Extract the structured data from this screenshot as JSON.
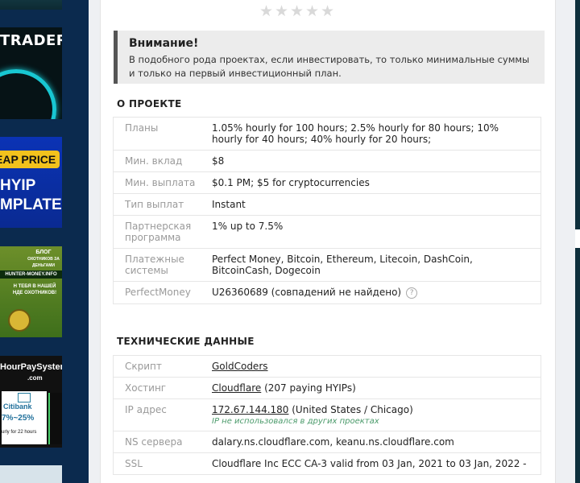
{
  "left_banners": {
    "trader": {
      "title": "TRADER"
    },
    "hyip": {
      "price_tag": "EAP PRICE",
      "line1": "HYIP",
      "line2": "MPLATE"
    },
    "hunter": {
      "blog": "БЛОГ",
      "blog_sub": "ОХОТНИКОВ ЗА ДЕНЬГАМИ",
      "url": "HUNTER-MONEY.INFO",
      "mid": "Н ТЕБЯ В НАШЕЙ НДЕ ОХОТНИКОВ!"
    },
    "hourpay": {
      "line1": "HourPaySystem",
      "line2": ".com",
      "bank": "Citibank",
      "pct": "7%~25%",
      "hours": "urly for 22 hours"
    }
  },
  "rating": {
    "stars": 5,
    "filled": 0,
    "icon": "star-icon"
  },
  "alert": {
    "title": "Внимание!",
    "text": "В подобного рода проектах, если инвестировать, то только минимальные суммы и только на первый инвестиционный план."
  },
  "about": {
    "title": "О ПРОЕКТЕ",
    "rows": [
      {
        "key": "Планы",
        "value": "1.05% hourly for 100 hours; 2.5% hourly for 80 hours; 10% hourly for 40 hours; 40% hourly for 20 hours;"
      },
      {
        "key": "Мин. вклад",
        "value": "$8"
      },
      {
        "key": "Мин. выплата",
        "value": "$0.1 PM; $5 for cryptocurrencies"
      },
      {
        "key": "Тип выплат",
        "value": "Instant"
      },
      {
        "key": "Партнерская программа",
        "value": "1% up to 7.5%"
      },
      {
        "key": "Платежные системы",
        "value": "Perfect Money, Bitcoin, Ethereum, Litecoin, DashCoin, BitcoinCash, Dogecoin"
      },
      {
        "key": "PerfectMoney",
        "value": "U26360689 (совпадений не найдено)",
        "help": "?"
      }
    ]
  },
  "tech": {
    "title": "ТЕХНИЧЕСКИЕ ДАННЫЕ",
    "script_key": "Скрипт",
    "script_link": "GoldCoders",
    "hosting_key": "Хостинг",
    "hosting_link": "Cloudflare",
    "hosting_rest": " (207 paying HYIPs)",
    "ip_key": "IP адрес",
    "ip_link": "172.67.144.180",
    "ip_rest": " (United States / Chicago)",
    "ip_note": "IP не использовался в других проектах",
    "ns_key": "NS сервера",
    "ns_value": "dalary.ns.cloudflare.com, keanu.ns.cloudflare.com",
    "ssl_key": "SSL",
    "ssl_value": "Cloudflare Inc ECC CA-3 valid from 03 Jan, 2021 to 03 Jan, 2022 -"
  },
  "colors": {
    "alert_border": "#555555",
    "alert_bg": "#ececec",
    "label_gray": "#9a9a9a",
    "note_green": "#4a9a6a"
  }
}
